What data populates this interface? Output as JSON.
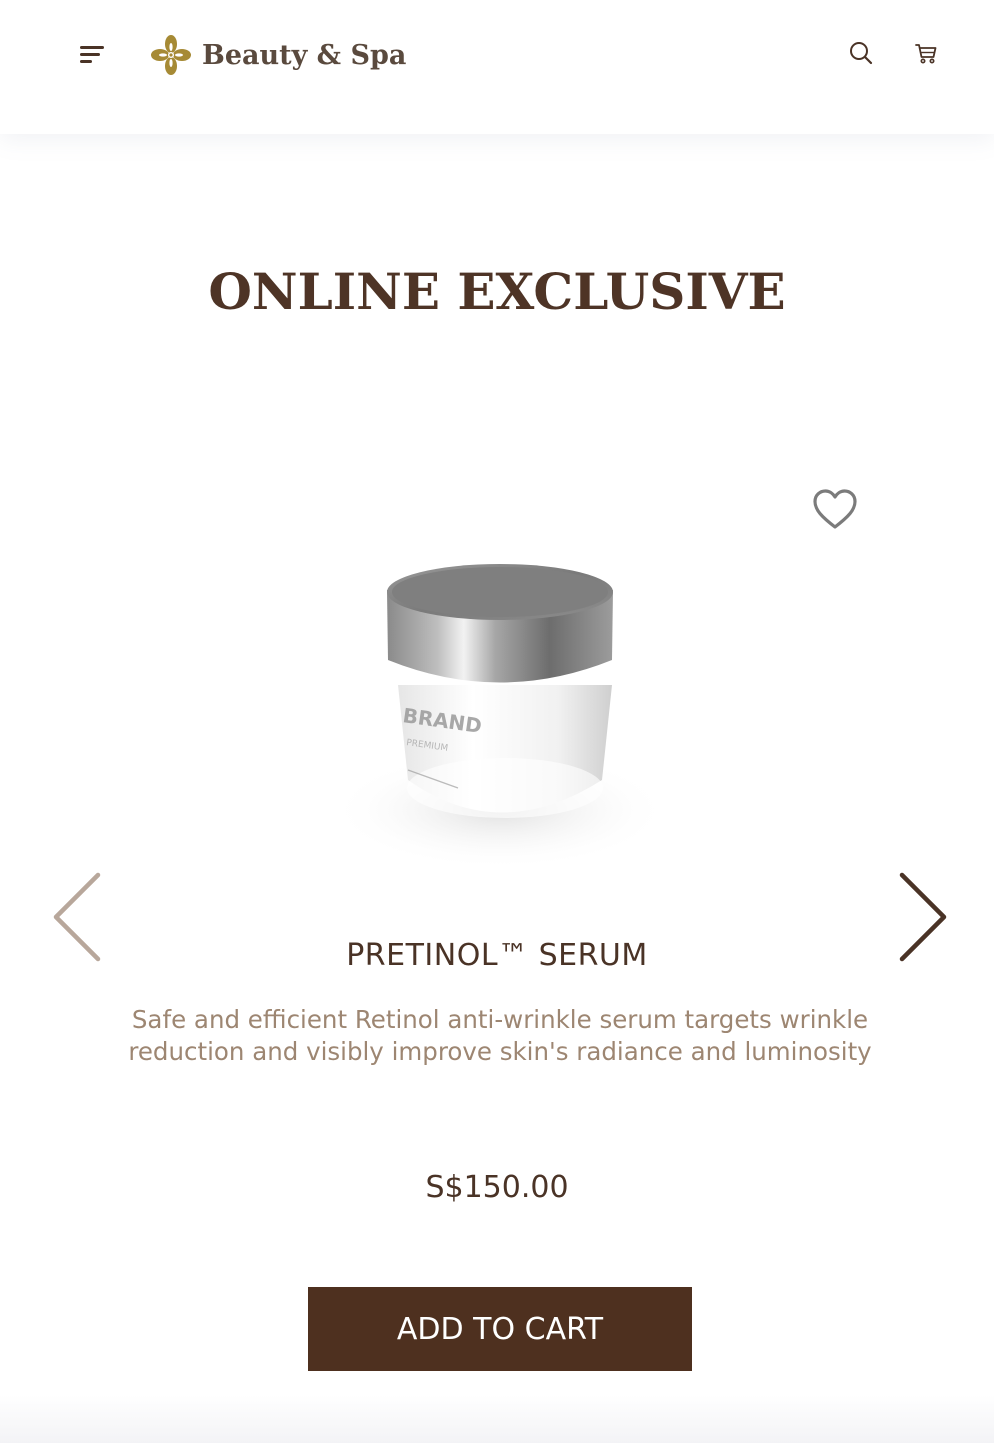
{
  "header": {
    "brand_name": "Beauty & Spa",
    "menu_icon": "menu-icon",
    "logo_icon": "flower-logo-icon",
    "search_icon": "search-icon",
    "cart_icon": "cart-icon",
    "brand_color": "#9b7d2c"
  },
  "section": {
    "title": "ONLINE EXCLUSIVE"
  },
  "product": {
    "name": "PRETINOL™ SERUM",
    "description": "Safe and efficient Retinol anti-wrinkle serum targets wrinkle reduction and visibly improve skin's radiance and luminosity",
    "price": "S$150.00",
    "image_label": "BRAND",
    "image_sublabel": "PREMIUM",
    "wishlist_icon": "heart-icon"
  },
  "carousel": {
    "prev_icon": "chevron-left-icon",
    "next_icon": "chevron-right-icon"
  },
  "actions": {
    "add_to_cart_label": "ADD TO CART"
  },
  "colors": {
    "accent": "#4e301f",
    "title": "#4e3426",
    "description": "#9d8672"
  }
}
